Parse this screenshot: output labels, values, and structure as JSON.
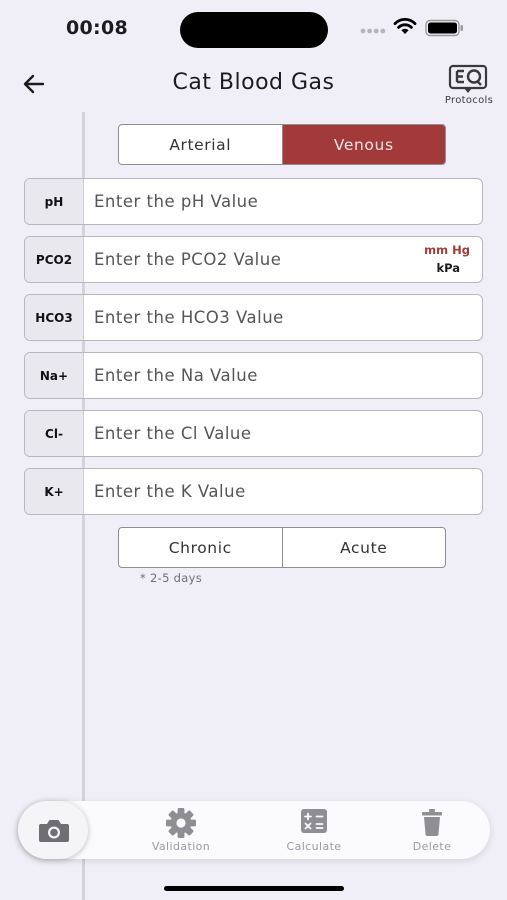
{
  "status_bar": {
    "time": "00:08"
  },
  "nav": {
    "title": "Cat Blood Gas",
    "protocols_label": "Protocols"
  },
  "blood_type": {
    "options": [
      "Arterial",
      "Venous"
    ],
    "selected": "Venous"
  },
  "fields": [
    {
      "label": "pH",
      "placeholder": "Enter the pH Value"
    },
    {
      "label": "PCO2",
      "placeholder": "Enter the PCO2 Value",
      "units": [
        "mm Hg",
        "kPa"
      ],
      "selected_unit": "mm Hg"
    },
    {
      "label": "HCO3",
      "placeholder": "Enter the HCO3 Value"
    },
    {
      "label": "Na+",
      "placeholder": "Enter the Na Value"
    },
    {
      "label": "Cl-",
      "placeholder": "Enter the Cl Value"
    },
    {
      "label": "K+",
      "placeholder": "Enter the K Value"
    }
  ],
  "duration": {
    "options": [
      "Chronic",
      "Acute"
    ],
    "note": "* 2-5 days"
  },
  "bottom_bar": {
    "validation": "Validation",
    "calculate": "Calculate",
    "delete": "Delete"
  },
  "colors": {
    "accent": "#a33a3a",
    "background": "#f0eff7",
    "tab_label": "#9a9aa0"
  },
  "icons": [
    "back-arrow-icon",
    "protocols-icon",
    "camera-icon",
    "gear-icon",
    "calculator-icon",
    "trash-icon",
    "wifi-icon",
    "battery-icon",
    "signal-icon"
  ]
}
